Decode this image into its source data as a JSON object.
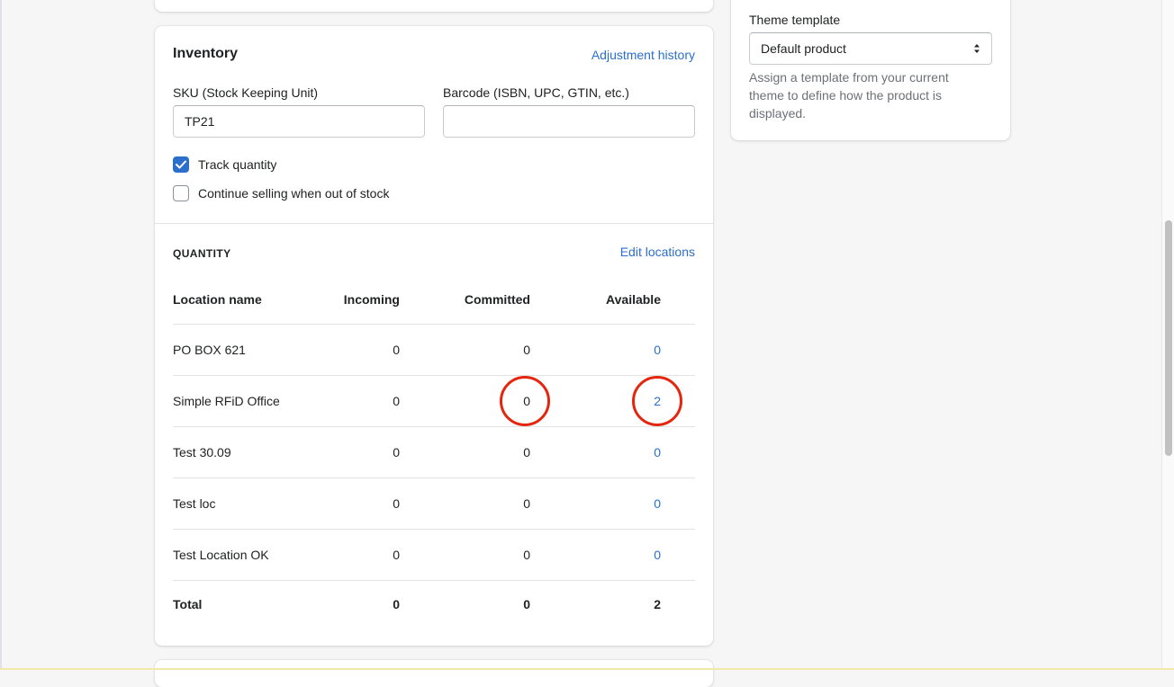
{
  "inventory": {
    "title": "Inventory",
    "adjustment_history_link": "Adjustment history",
    "sku": {
      "label": "SKU (Stock Keeping Unit)",
      "value": "TP21"
    },
    "barcode": {
      "label": "Barcode (ISBN, UPC, GTIN, etc.)",
      "value": ""
    },
    "track_quantity": {
      "label": "Track quantity",
      "checked": true
    },
    "continue_selling": {
      "label": "Continue selling when out of stock",
      "checked": false
    }
  },
  "quantity": {
    "section_title": "QUANTITY",
    "edit_locations_link": "Edit locations",
    "headers": {
      "location": "Location name",
      "incoming": "Incoming",
      "committed": "Committed",
      "available": "Available"
    },
    "rows": [
      {
        "name": "PO BOX 621",
        "incoming": "0",
        "committed": "0",
        "available": "0"
      },
      {
        "name": "Simple RFiD Office",
        "incoming": "0",
        "committed": "0",
        "available": "2"
      },
      {
        "name": "Test 30.09",
        "incoming": "0",
        "committed": "0",
        "available": "0"
      },
      {
        "name": "Test loc",
        "incoming": "0",
        "committed": "0",
        "available": "0"
      },
      {
        "name": "Test Location OK",
        "incoming": "0",
        "committed": "0",
        "available": "0"
      }
    ],
    "total": {
      "label": "Total",
      "incoming": "0",
      "committed": "0",
      "available": "2"
    }
  },
  "theme_template": {
    "label": "Theme template",
    "selected": "Default product",
    "help_text": "Assign a template from your current theme to define how the product is displayed."
  },
  "colors": {
    "link": "#2c6ecb",
    "highlight": "#e5260f",
    "checkbox_checked": "#2c6ecb"
  },
  "icons": {
    "checkmark": "checkmark-icon",
    "select_arrows": "select-arrows-icon"
  }
}
